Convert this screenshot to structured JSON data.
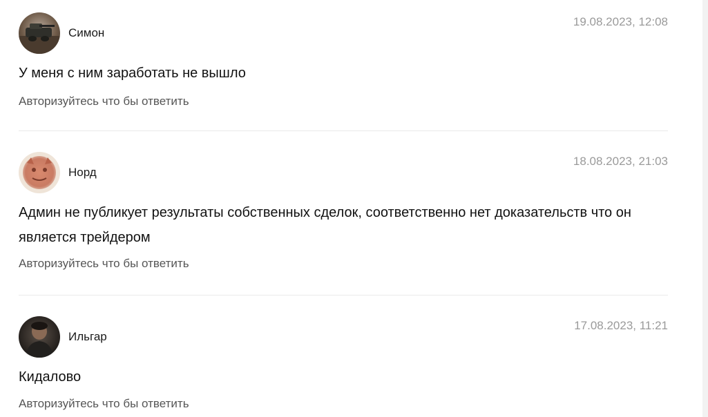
{
  "comments": [
    {
      "author": "Симон",
      "date": "19.08.2023, 12:08",
      "text": "У меня с ним заработать не вышло",
      "reply_label": "Авторизуйтесь что бы ответить"
    },
    {
      "author": "Норд",
      "date": "18.08.2023, 21:03",
      "text": "Админ не публикует результаты собственных сделок, соответственно нет доказательств что он является трейдером",
      "reply_label": "Авторизуйтесь что бы ответить"
    },
    {
      "author": "Ильгар",
      "date": "17.08.2023, 11:21",
      "text": "Кидалово",
      "reply_label": "Авторизуйтесь что бы ответить"
    }
  ]
}
